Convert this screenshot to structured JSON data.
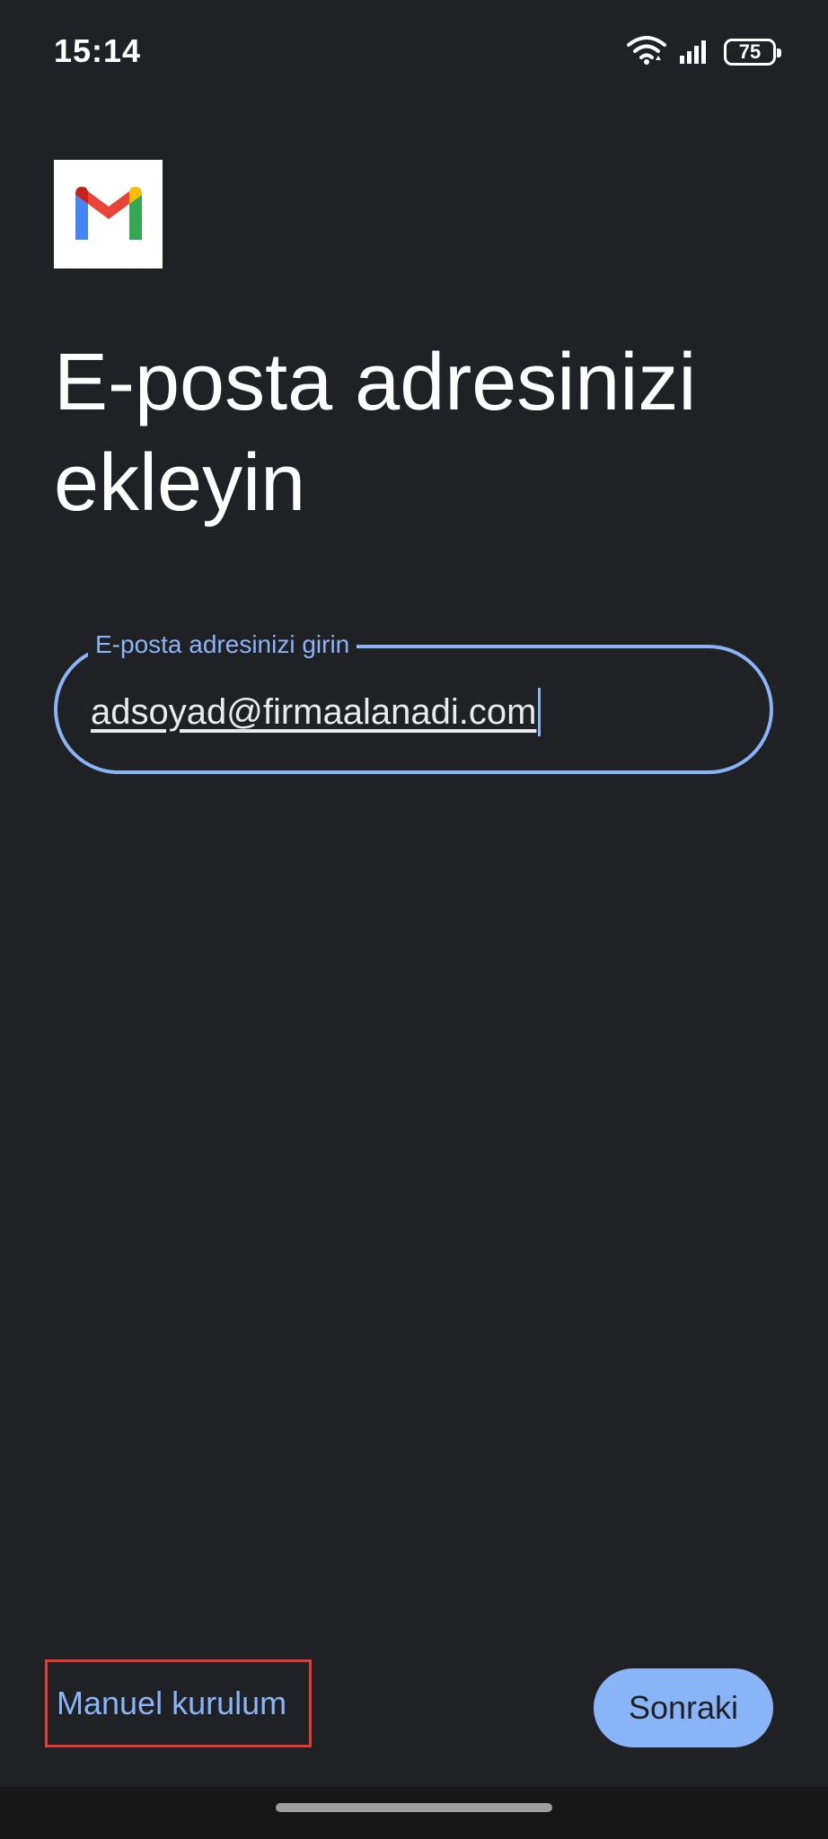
{
  "status_bar": {
    "time": "15:14",
    "battery_level": "75",
    "icons": [
      "wifi-icon",
      "signal-icon",
      "battery-icon"
    ]
  },
  "app": {
    "logo_icon": "gmail-icon"
  },
  "page": {
    "title": "E-posta adresinizi ekleyin"
  },
  "email_field": {
    "label": "E-posta adresinizi girin",
    "value": "adsoyad@firmaalanadi.com"
  },
  "actions": {
    "manual_setup": "Manuel kurulum",
    "next": "Sonraki"
  },
  "colors": {
    "background": "#202124",
    "accent": "#8ab4f8",
    "highlight_box": "#e53935",
    "nav_bar": "#171717"
  }
}
